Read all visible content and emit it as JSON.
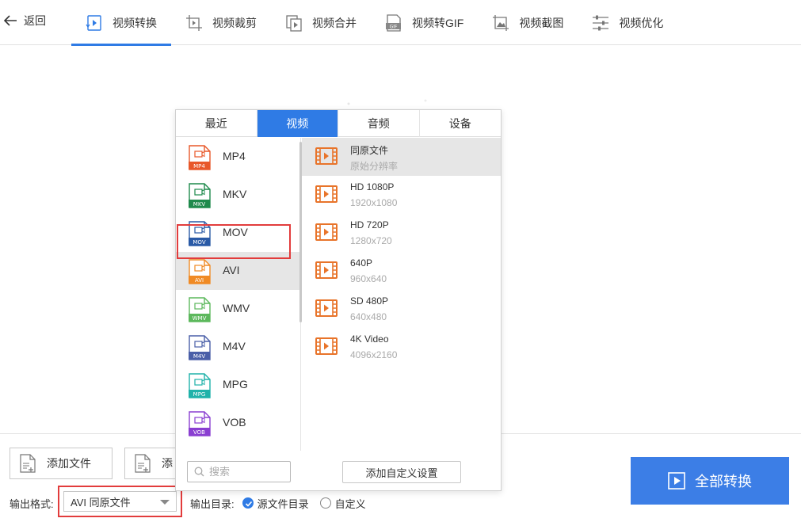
{
  "header": {
    "back_label": "返回",
    "tabs": [
      {
        "label": "视频转换",
        "icon": "video-convert-icon",
        "active": true
      },
      {
        "label": "视频裁剪",
        "icon": "video-crop-icon",
        "active": false
      },
      {
        "label": "视频合并",
        "icon": "video-merge-icon",
        "active": false
      },
      {
        "label": "视频转GIF",
        "icon": "gif-icon",
        "active": false
      },
      {
        "label": "视频截图",
        "icon": "screenshot-icon",
        "active": false
      },
      {
        "label": "视频优化",
        "icon": "optimize-icon",
        "active": false
      }
    ]
  },
  "popup": {
    "tabs": [
      {
        "label": "最近",
        "active": false
      },
      {
        "label": "视频",
        "active": true
      },
      {
        "label": "音频",
        "active": false
      },
      {
        "label": "设备",
        "active": false
      }
    ],
    "formats": [
      {
        "name": "MP4",
        "badge": "MP4",
        "color": "#e8582a"
      },
      {
        "name": "MKV",
        "badge": "MKV",
        "color": "#1f8a4c"
      },
      {
        "name": "MOV",
        "badge": "MOV",
        "color": "#2a5aa6"
      },
      {
        "name": "AVI",
        "badge": "AVI",
        "color": "#f08a24",
        "selected": true
      },
      {
        "name": "WMV",
        "badge": "WMV",
        "color": "#5cb85c"
      },
      {
        "name": "M4V",
        "badge": "M4V",
        "color": "#4a5fa8"
      },
      {
        "name": "MPG",
        "badge": "MPG",
        "color": "#20b2aa"
      },
      {
        "name": "VOB",
        "badge": "VOB",
        "color": "#8a3fd1"
      }
    ],
    "resolutions": [
      {
        "name": "同原文件",
        "desc": "原始分辨率",
        "selected": true
      },
      {
        "name": "HD 1080P",
        "desc": "1920x1080"
      },
      {
        "name": "HD 720P",
        "desc": "1280x720"
      },
      {
        "name": "640P",
        "desc": "960x640"
      },
      {
        "name": "SD 480P",
        "desc": "640x480"
      },
      {
        "name": "4K Video",
        "desc": "4096x2160"
      }
    ],
    "search_placeholder": "搜索",
    "custom_button": "添加自定义设置",
    "accent_color": "#2f7be5"
  },
  "bottom": {
    "add_file_label": "添加文件",
    "add_folder_label": "添",
    "format_label": "输出格式:",
    "format_value": "AVI 同原文件",
    "output_dir_label": "输出目录:",
    "radio_source": "源文件目录",
    "radio_custom": "自定义",
    "convert_all_label": "全部转换"
  }
}
